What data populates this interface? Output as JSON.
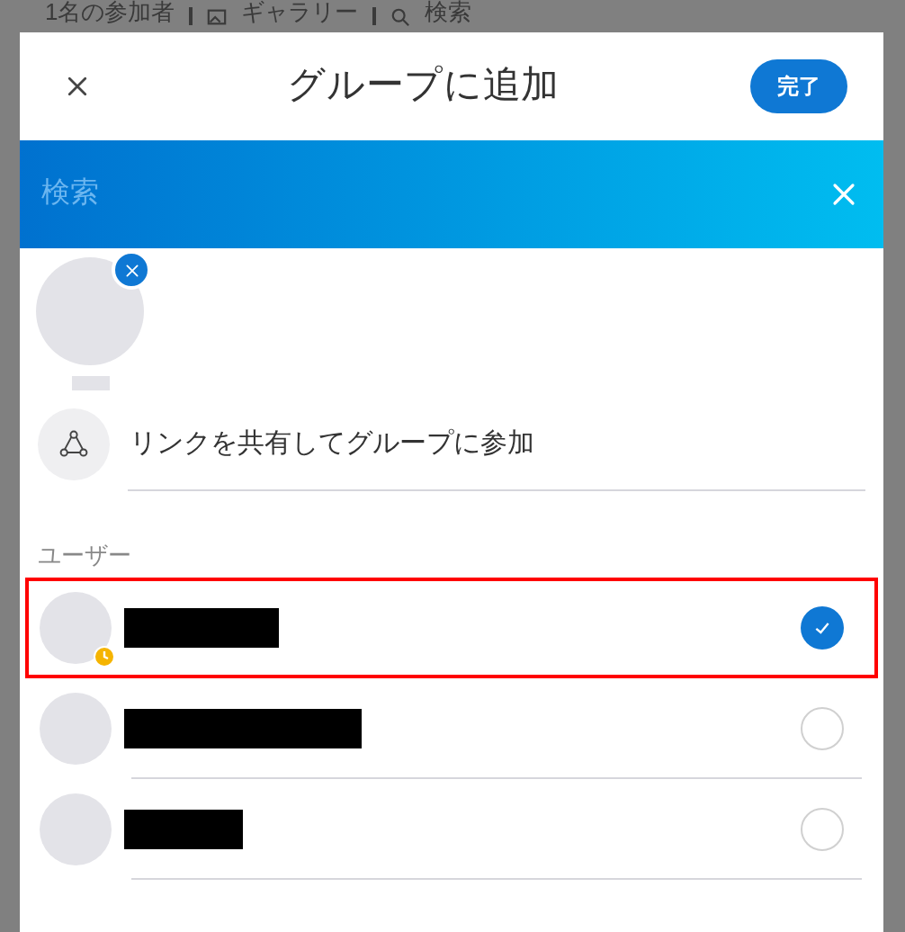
{
  "background": {
    "toolbar": [
      {
        "kind": "text",
        "label": "1名の参加者"
      },
      {
        "kind": "gallery",
        "label": "ギャラリー"
      },
      {
        "kind": "search",
        "label": "検索"
      }
    ]
  },
  "dialog": {
    "title": "グループに追加",
    "done_button": "完了",
    "search": {
      "placeholder": "検索"
    },
    "selected_chips": [
      {
        "name_redacted": true
      }
    ],
    "share_link": {
      "label": "リンクを共有してグループに参加"
    },
    "section_label": "ユーザー",
    "users": [
      {
        "name_redacted": true,
        "checked": true,
        "highlighted": true,
        "pending": true
      },
      {
        "name_redacted": true,
        "checked": false,
        "highlighted": false,
        "pending": false
      },
      {
        "name_redacted": true,
        "checked": false,
        "highlighted": false,
        "pending": false
      }
    ]
  }
}
